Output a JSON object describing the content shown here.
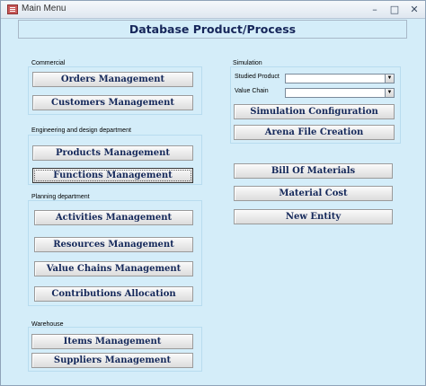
{
  "window": {
    "title": "Main Menu",
    "controls": {
      "minimize": "–",
      "maximize": "□",
      "close": "✕"
    }
  },
  "header": {
    "title": "Database Product/Process"
  },
  "commercial": {
    "label": "Commercial",
    "buttons": [
      "Orders Management",
      "Customers Management"
    ]
  },
  "engineering": {
    "label": "Engineering and design department",
    "buttons": [
      "Products Management",
      "Functions Management"
    ]
  },
  "planning": {
    "label": "Planning department",
    "buttons": [
      "Activities Management",
      "Resources Management",
      "Value Chains Management",
      "Contributions Allocation"
    ]
  },
  "warehouse": {
    "label": "Warehouse",
    "buttons": [
      "Items Management",
      "Suppliers Management"
    ]
  },
  "simulation": {
    "label": "Simulation",
    "fields": [
      {
        "label": "Studied Product",
        "value": ""
      },
      {
        "label": "Value Chain",
        "value": ""
      }
    ],
    "buttons": [
      "Simulation Configuration",
      "Arena File Creation"
    ]
  },
  "other": {
    "buttons": [
      "Bill Of Materials",
      "Material Cost",
      "New Entity"
    ]
  },
  "icons": [
    "app-icon",
    "dropdown-arrow-icon"
  ]
}
